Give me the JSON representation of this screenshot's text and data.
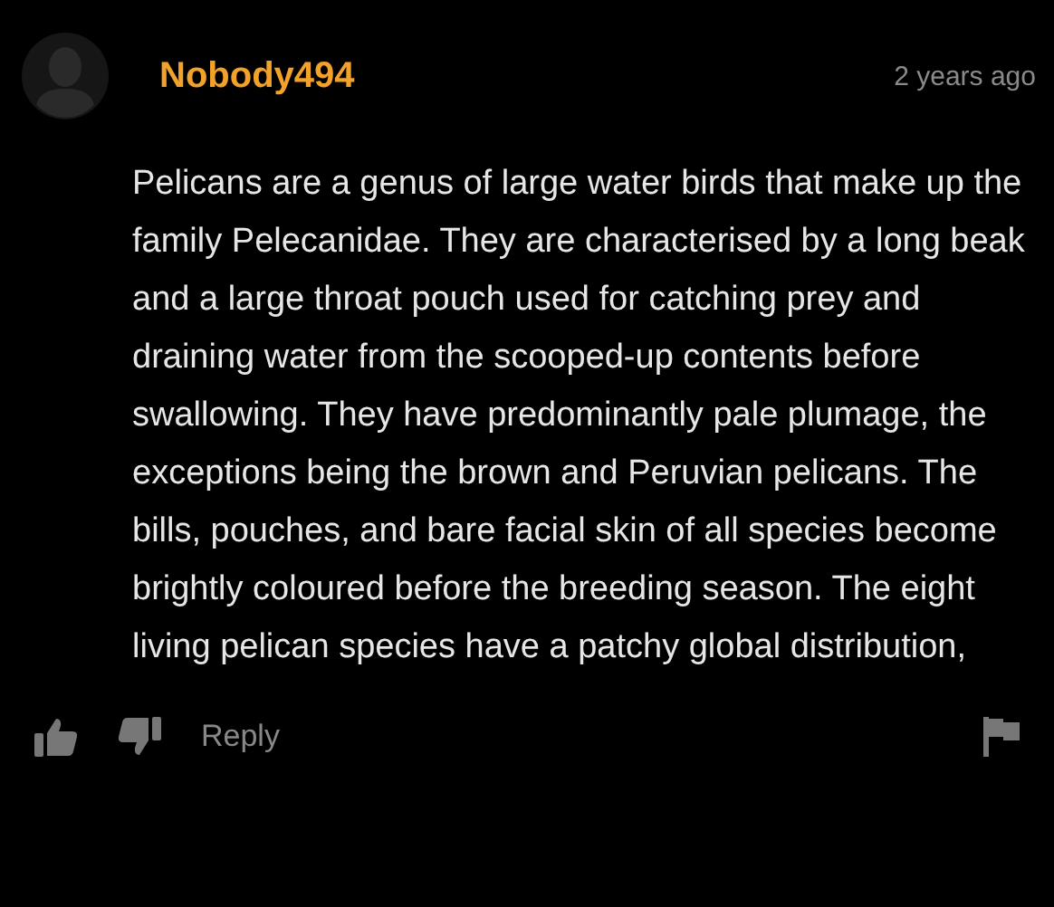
{
  "comment": {
    "username": "Nobody494",
    "time": "2 years ago",
    "text": "Pelicans are a genus of large water birds that make up the family Pelecanidae. They are characterised by a long beak and a large throat pouch used for catching prey and draining water from the scooped-up contents before swallowing. They have predominantly pale plumage, the exceptions being the brown and Peruvian pelicans. The bills, pouches, and bare facial skin of all species become brightly coloured before the breeding season. The eight living pelican species have a patchy global distribution,"
  },
  "actions": {
    "reply": "Reply"
  }
}
